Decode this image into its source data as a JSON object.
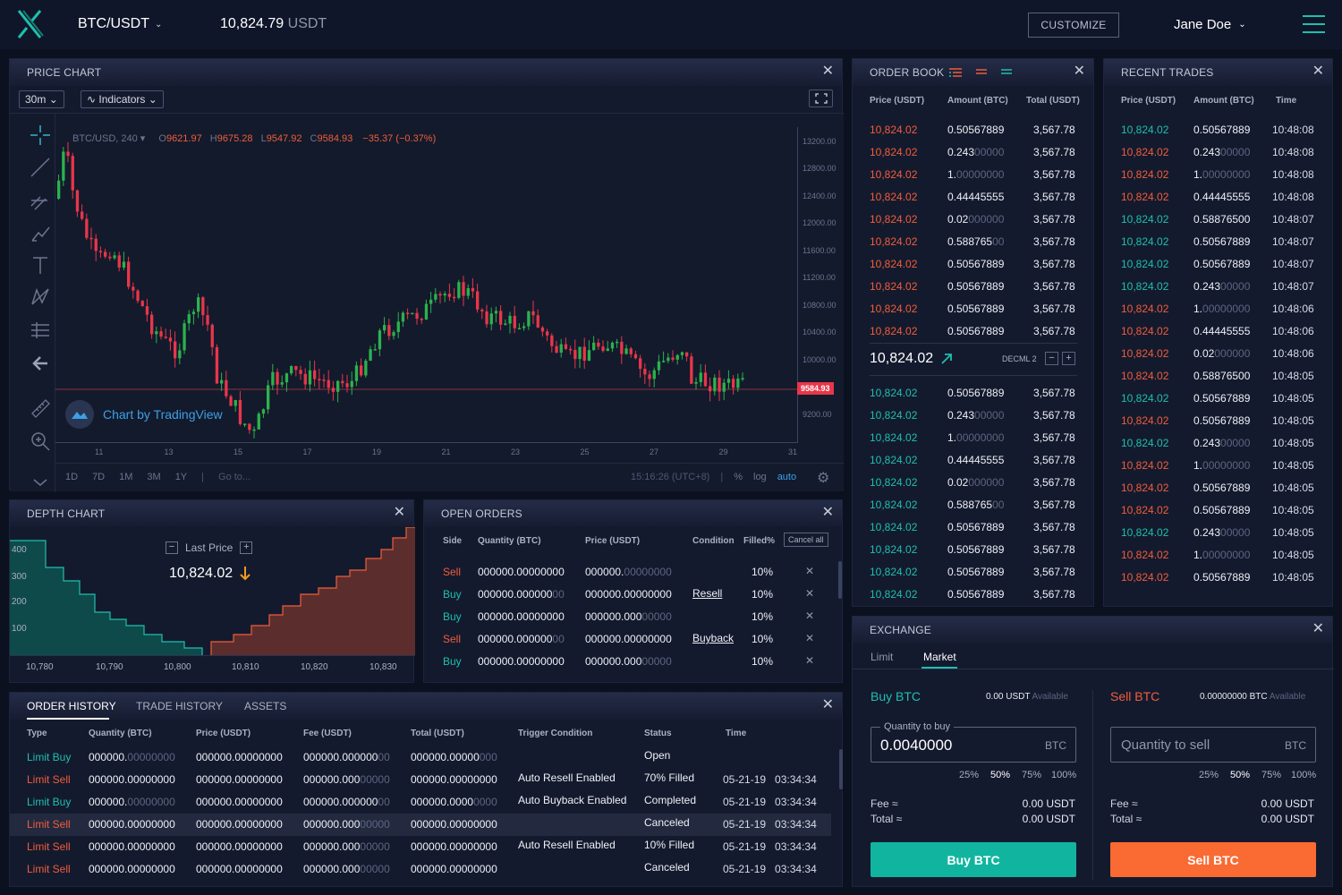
{
  "topbar": {
    "pair": "BTC/USDT",
    "price": "10,824.79",
    "price_unit": "USDT",
    "customize": "CUSTOMIZE",
    "user": "Jane Doe"
  },
  "price_chart": {
    "title": "PRICE CHART",
    "interval": "30m",
    "indicators": "Indicators",
    "symbol": "BTC/USD, 240",
    "ohlc": {
      "o_label": "O",
      "o": "9621.97",
      "h_label": "H",
      "h": "9675.28",
      "l_label": "L",
      "l": "9547.92",
      "c_label": "C",
      "c": "9584.93",
      "chg": "−35.37 (−0.37%)"
    },
    "yticks": [
      "13200.00",
      "12800.00",
      "12400.00",
      "12000.00",
      "11600.00",
      "11200.00",
      "10800.00",
      "10400.00",
      "10000.00",
      "9200.00"
    ],
    "xticks": [
      "11",
      "13",
      "15",
      "17",
      "19",
      "21",
      "23",
      "25",
      "27",
      "29",
      "31"
    ],
    "last_label": "9584.93",
    "credit": "Chart by TradingView",
    "ranges": [
      "1D",
      "7D",
      "1M",
      "3M",
      "1Y"
    ],
    "goto": "Go to...",
    "time": "15:16:26 (UTC+8)",
    "pct": "%",
    "log": "log",
    "auto": "auto"
  },
  "chart_data": {
    "type": "candlestick",
    "y_axis": [
      9200,
      13200
    ],
    "x_ticks": [
      "11",
      "13",
      "15",
      "17",
      "19",
      "21",
      "23",
      "25",
      "27",
      "29",
      "31"
    ],
    "last_price": 9584.93
  },
  "order_book": {
    "title": "ORDER BOOK",
    "headers": [
      "Price (USDT)",
      "Amount (BTC)",
      "Total (USDT)"
    ],
    "asks": [
      [
        "10,824.02",
        "0.50567889",
        "",
        "3,567.78"
      ],
      [
        "10,824.02",
        "0.243",
        "00000",
        "3,567.78"
      ],
      [
        "10,824.02",
        "1.",
        "00000000",
        "3,567.78"
      ],
      [
        "10,824.02",
        "0.44445555",
        "",
        "3,567.78"
      ],
      [
        "10,824.02",
        "0.02",
        "000000",
        "3,567.78"
      ],
      [
        "10,824.02",
        "0.588765",
        "00",
        "3,567.78"
      ],
      [
        "10,824.02",
        "0.50567889",
        "",
        "3,567.78"
      ],
      [
        "10,824.02",
        "0.50567889",
        "",
        "3,567.78"
      ],
      [
        "10,824.02",
        "0.50567889",
        "",
        "3,567.78"
      ],
      [
        "10,824.02",
        "0.50567889",
        "",
        "3,567.78"
      ]
    ],
    "mid_price": "10,824.02",
    "decimal": "DECML 2",
    "bids": [
      [
        "10,824.02",
        "0.50567889",
        "",
        "3,567.78"
      ],
      [
        "10,824.02",
        "0.243",
        "00000",
        "3,567.78"
      ],
      [
        "10,824.02",
        "1.",
        "00000000",
        "3,567.78"
      ],
      [
        "10,824.02",
        "0.44445555",
        "",
        "3,567.78"
      ],
      [
        "10,824.02",
        "0.02",
        "000000",
        "3,567.78"
      ],
      [
        "10,824.02",
        "0.588765",
        "00",
        "3,567.78"
      ],
      [
        "10,824.02",
        "0.50567889",
        "",
        "3,567.78"
      ],
      [
        "10,824.02",
        "0.50567889",
        "",
        "3,567.78"
      ],
      [
        "10,824.02",
        "0.50567889",
        "",
        "3,567.78"
      ],
      [
        "10,824.02",
        "0.50567889",
        "",
        "3,567.78"
      ]
    ]
  },
  "recent_trades": {
    "title": "RECENT TRADES",
    "headers": [
      "Price (USDT)",
      "Amount (BTC)",
      "Time"
    ],
    "rows": [
      [
        "buy",
        "10,824.02",
        "0.50567889",
        "",
        "10:48:08"
      ],
      [
        "sell",
        "10,824.02",
        "0.243",
        "00000",
        "10:48:08"
      ],
      [
        "sell",
        "10,824.02",
        "1.",
        "00000000",
        "10:48:08"
      ],
      [
        "sell",
        "10,824.02",
        "0.44445555",
        "",
        "10:48:08"
      ],
      [
        "buy",
        "10,824.02",
        "0.58876500",
        "",
        "10:48:07"
      ],
      [
        "buy",
        "10,824.02",
        "0.50567889",
        "",
        "10:48:07"
      ],
      [
        "buy",
        "10,824.02",
        "0.50567889",
        "",
        "10:48:07"
      ],
      [
        "buy",
        "10,824.02",
        "0.243",
        "00000",
        "10:48:07"
      ],
      [
        "sell",
        "10,824.02",
        "1.",
        "00000000",
        "10:48:06"
      ],
      [
        "sell",
        "10,824.02",
        "0.44445555",
        "",
        "10:48:06"
      ],
      [
        "sell",
        "10,824.02",
        "0.02",
        "000000",
        "10:48:06"
      ],
      [
        "sell",
        "10,824.02",
        "0.58876500",
        "",
        "10:48:05"
      ],
      [
        "buy",
        "10,824.02",
        "0.50567889",
        "",
        "10:48:05"
      ],
      [
        "sell",
        "10,824.02",
        "0.50567889",
        "",
        "10:48:05"
      ],
      [
        "buy",
        "10,824.02",
        "0.243",
        "00000",
        "10:48:05"
      ],
      [
        "sell",
        "10,824.02",
        "1.",
        "00000000",
        "10:48:05"
      ],
      [
        "sell",
        "10,824.02",
        "0.50567889",
        "",
        "10:48:05"
      ],
      [
        "sell",
        "10,824.02",
        "0.50567889",
        "",
        "10:48:05"
      ],
      [
        "buy",
        "10,824.02",
        "0.243",
        "00000",
        "10:48:05"
      ],
      [
        "sell",
        "10,824.02",
        "1.",
        "00000000",
        "10:48:05"
      ],
      [
        "sell",
        "10,824.02",
        "0.50567889",
        "",
        "10:48:05"
      ]
    ]
  },
  "depth_chart": {
    "title": "DEPTH CHART",
    "last_price_label": "Last Price",
    "last_price": "10,824.02",
    "yticks": [
      "400",
      "300",
      "200",
      "100"
    ],
    "xticks": [
      "10,780",
      "10,790",
      "10,800",
      "10,810",
      "10,820",
      "10,830"
    ]
  },
  "open_orders": {
    "title": "OPEN ORDERS",
    "headers": [
      "Side",
      "Quantity (BTC)",
      "Price (USDT)",
      "Condition",
      "Filled%"
    ],
    "cancel_all": "Cancel all",
    "rows": [
      [
        "Sell",
        "000000.00000000",
        "",
        "000000.",
        "00000000",
        "",
        "10%"
      ],
      [
        "Buy",
        "000000.000000",
        "00",
        "000000.00000000",
        "",
        "Resell",
        "10%"
      ],
      [
        "Buy",
        "000000.00000000",
        "",
        "000000.000",
        "00000",
        "",
        "10%"
      ],
      [
        "Sell",
        "000000.000000",
        "00",
        "000000.00000000",
        "",
        "Buyback",
        "10%"
      ],
      [
        "Buy",
        "000000.00000000",
        "",
        "000000.000",
        "00000",
        "",
        "10%"
      ]
    ]
  },
  "exchange": {
    "title": "EXCHANGE",
    "tabs": [
      "Limit",
      "Market"
    ],
    "buy": {
      "title": "Buy BTC",
      "avail": "0.00 USDT",
      "avail_label": "Available",
      "field_label": "Quantity to buy",
      "value": "0.0040000",
      "unit": "BTC",
      "pcts": [
        "25%",
        "50%",
        "75%",
        "100%"
      ],
      "fee_label": "Fee ≈",
      "fee": "0.00 USDT",
      "total_label": "Total ≈",
      "total": "0.00 USDT",
      "button": "Buy BTC"
    },
    "sell": {
      "title": "Sell BTC",
      "avail": "0.00000000 BTC",
      "avail_label": "Available",
      "placeholder": "Quantity to sell",
      "unit": "BTC",
      "pcts": [
        "25%",
        "50%",
        "75%",
        "100%"
      ],
      "fee_label": "Fee ≈",
      "fee": "0.00 USDT",
      "total_label": "Total ≈",
      "total": "0.00 USDT",
      "button": "Sell BTC"
    }
  },
  "history": {
    "tabs": [
      "ORDER HISTORY",
      "TRADE HISTORY",
      "ASSETS"
    ],
    "headers": [
      "Type",
      "Quantity (BTC)",
      "Price (USDT)",
      "Fee (USDT)",
      "Total (USDT)",
      "Trigger Condition",
      "Status",
      "Time"
    ],
    "rows": [
      [
        "Limit Buy",
        "000000.",
        "00000000",
        "000000.00000000",
        "",
        "000000.000000",
        "00",
        "000000.00000",
        "000",
        "",
        "Open",
        ""
      ],
      [
        "Limit Sell",
        "000000.00000000",
        "",
        "000000.00000000",
        "",
        "000000.000",
        "00000",
        "000000.00000000",
        "",
        "Auto Resell Enabled",
        "70% Filled",
        "05-21-19   03:34:34"
      ],
      [
        "Limit Buy",
        "000000.",
        "00000000",
        "000000.00000000",
        "",
        "000000.000000",
        "00",
        "000000.0000",
        "0000",
        "Auto Buyback Enabled",
        "Completed",
        "05-21-19   03:34:34"
      ],
      [
        "Limit Sell",
        "000000.00000000",
        "",
        "000000.00000000",
        "",
        "000000.000",
        "00000",
        "000000.00000000",
        "",
        "",
        "Canceled",
        "05-21-19   03:34:34"
      ],
      [
        "Limit Sell",
        "000000.00000000",
        "",
        "000000.00000000",
        "",
        "000000.000",
        "00000",
        "000000.00000000",
        "",
        "Auto Resell Enabled",
        "10% Filled",
        "05-21-19   03:34:34"
      ],
      [
        "Limit Sell",
        "000000.00000000",
        "",
        "000000.00000000",
        "",
        "000000.000",
        "00000",
        "000000.00000000",
        "",
        "",
        "Canceled",
        "05-21-19   03:34:34"
      ]
    ]
  },
  "colors": {
    "buy": "#1fbfae",
    "sell": "#f05d3a",
    "bg": "#0c1120",
    "panel": "#141a2e"
  }
}
